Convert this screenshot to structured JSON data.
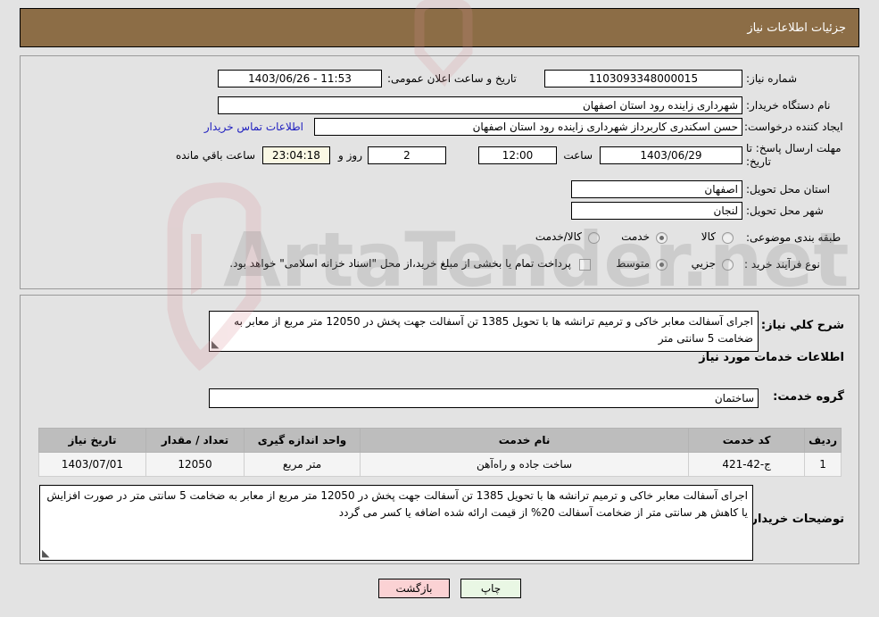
{
  "header": {
    "title": "جزئیات اطلاعات نیاز",
    "bg": "#8c6d46"
  },
  "form": {
    "need_number_label": "شماره نیاز:",
    "need_number_value": "1103093348000015",
    "announce_label": "تاریخ و ساعت اعلان عمومی:",
    "announce_value": "11:53 - 1403/06/26",
    "buyer_org_label": "نام دستگاه خریدار:",
    "buyer_org_value": "شهرداری زاینده رود استان اصفهان",
    "requester_label": "ایجاد کننده درخواست:",
    "requester_value": "حسن  اسکندری  کاربرداز شهرداری زاینده رود استان اصفهان",
    "contact_link": "اطلاعات تماس خریدار",
    "deadline_label": "مهلت ارسال پاسخ: تا تاریخ:",
    "deadline_date": "1403/06/29",
    "hour_label": "ساعت",
    "hour_value": "12:00",
    "days_value": "2",
    "days_label": "روز و",
    "countdown_value": "23:04:18",
    "remaining_label": "ساعت باقي مانده",
    "province_label": "استان محل تحویل:",
    "province_value": "اصفهان",
    "city_label": "شهر محل تحویل:",
    "city_value": "لنجان",
    "category_label": "طبقه بندی موضوعی:",
    "category_options": [
      {
        "label": "کالا",
        "selected": false
      },
      {
        "label": "خدمت",
        "selected": true
      },
      {
        "label": "کالا/خدمت",
        "selected": false
      }
    ],
    "process_label": "نوع فرآیند خرید :",
    "process_options": [
      {
        "label": "جزیي",
        "selected": false
      },
      {
        "label": "متوسط",
        "selected": true
      }
    ],
    "treasury_checkbox_checked": false,
    "treasury_text": "پرداخت تمام یا بخشی از مبلغ خرید،از محل \"اسناد خزانه اسلامی\" خواهد بود."
  },
  "summary": {
    "label": "شرح کلي نیاز:",
    "text": "اجرای آسفالت معابر خاکی و ترمیم ترانشه ها با تحویل 1385 تن آسفالت جهت پخش در 12050 متر مربع از معابر به ضخامت 5 سانتی متر"
  },
  "services_section": {
    "heading": "اطلاعات خدمات مورد نیاز",
    "group_label": "گروه خدمت:",
    "group_value": "ساختمان"
  },
  "table": {
    "columns": [
      "ردیف",
      "کد خدمت",
      "نام خدمت",
      "واحد اندازه گیری",
      "تعداد / مقدار",
      "تاریخ نیاز"
    ],
    "rows": [
      {
        "row_no": "1",
        "service_code": "ج-42-421",
        "service_name": "ساخت جاده و راه‌آهن",
        "unit": "متر مربع",
        "quantity": "12050",
        "need_date": "1403/07/01"
      }
    ]
  },
  "buyer_notes": {
    "label": "توضیحات خریدار:",
    "text": "اجرای آسفالت معابر خاکی و ترمیم ترانشه ها با تحویل 1385 تن آسفالت جهت پخش در 12050 متر مربع از معابر به ضخامت 5 سانتی متر در صورت افزایش یا کاهش هر سانتی متر از ضخامت آسفالت 20% از قیمت ارائه شده اضافه یا کسر می گردد"
  },
  "footer": {
    "print_label": "چاپ",
    "back_label": "بازگشت"
  },
  "watermark": {
    "text": "ArtaTender.net"
  }
}
